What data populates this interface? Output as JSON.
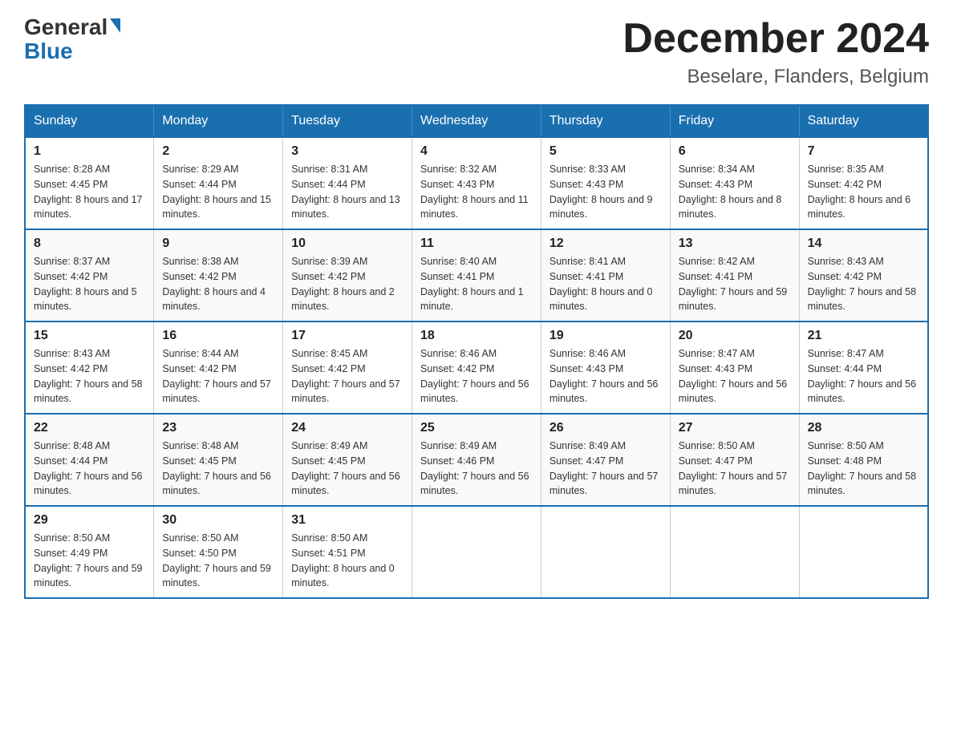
{
  "logo": {
    "general": "General",
    "blue": "Blue",
    "triangle": "▶"
  },
  "title": {
    "month": "December 2024",
    "location": "Beselare, Flanders, Belgium"
  },
  "weekdays": [
    "Sunday",
    "Monday",
    "Tuesday",
    "Wednesday",
    "Thursday",
    "Friday",
    "Saturday"
  ],
  "weeks": [
    [
      {
        "day": "1",
        "sunrise": "8:28 AM",
        "sunset": "4:45 PM",
        "daylight": "8 hours and 17 minutes."
      },
      {
        "day": "2",
        "sunrise": "8:29 AM",
        "sunset": "4:44 PM",
        "daylight": "8 hours and 15 minutes."
      },
      {
        "day": "3",
        "sunrise": "8:31 AM",
        "sunset": "4:44 PM",
        "daylight": "8 hours and 13 minutes."
      },
      {
        "day": "4",
        "sunrise": "8:32 AM",
        "sunset": "4:43 PM",
        "daylight": "8 hours and 11 minutes."
      },
      {
        "day": "5",
        "sunrise": "8:33 AM",
        "sunset": "4:43 PM",
        "daylight": "8 hours and 9 minutes."
      },
      {
        "day": "6",
        "sunrise": "8:34 AM",
        "sunset": "4:43 PM",
        "daylight": "8 hours and 8 minutes."
      },
      {
        "day": "7",
        "sunrise": "8:35 AM",
        "sunset": "4:42 PM",
        "daylight": "8 hours and 6 minutes."
      }
    ],
    [
      {
        "day": "8",
        "sunrise": "8:37 AM",
        "sunset": "4:42 PM",
        "daylight": "8 hours and 5 minutes."
      },
      {
        "day": "9",
        "sunrise": "8:38 AM",
        "sunset": "4:42 PM",
        "daylight": "8 hours and 4 minutes."
      },
      {
        "day": "10",
        "sunrise": "8:39 AM",
        "sunset": "4:42 PM",
        "daylight": "8 hours and 2 minutes."
      },
      {
        "day": "11",
        "sunrise": "8:40 AM",
        "sunset": "4:41 PM",
        "daylight": "8 hours and 1 minute."
      },
      {
        "day": "12",
        "sunrise": "8:41 AM",
        "sunset": "4:41 PM",
        "daylight": "8 hours and 0 minutes."
      },
      {
        "day": "13",
        "sunrise": "8:42 AM",
        "sunset": "4:41 PM",
        "daylight": "7 hours and 59 minutes."
      },
      {
        "day": "14",
        "sunrise": "8:43 AM",
        "sunset": "4:42 PM",
        "daylight": "7 hours and 58 minutes."
      }
    ],
    [
      {
        "day": "15",
        "sunrise": "8:43 AM",
        "sunset": "4:42 PM",
        "daylight": "7 hours and 58 minutes."
      },
      {
        "day": "16",
        "sunrise": "8:44 AM",
        "sunset": "4:42 PM",
        "daylight": "7 hours and 57 minutes."
      },
      {
        "day": "17",
        "sunrise": "8:45 AM",
        "sunset": "4:42 PM",
        "daylight": "7 hours and 57 minutes."
      },
      {
        "day": "18",
        "sunrise": "8:46 AM",
        "sunset": "4:42 PM",
        "daylight": "7 hours and 56 minutes."
      },
      {
        "day": "19",
        "sunrise": "8:46 AM",
        "sunset": "4:43 PM",
        "daylight": "7 hours and 56 minutes."
      },
      {
        "day": "20",
        "sunrise": "8:47 AM",
        "sunset": "4:43 PM",
        "daylight": "7 hours and 56 minutes."
      },
      {
        "day": "21",
        "sunrise": "8:47 AM",
        "sunset": "4:44 PM",
        "daylight": "7 hours and 56 minutes."
      }
    ],
    [
      {
        "day": "22",
        "sunrise": "8:48 AM",
        "sunset": "4:44 PM",
        "daylight": "7 hours and 56 minutes."
      },
      {
        "day": "23",
        "sunrise": "8:48 AM",
        "sunset": "4:45 PM",
        "daylight": "7 hours and 56 minutes."
      },
      {
        "day": "24",
        "sunrise": "8:49 AM",
        "sunset": "4:45 PM",
        "daylight": "7 hours and 56 minutes."
      },
      {
        "day": "25",
        "sunrise": "8:49 AM",
        "sunset": "4:46 PM",
        "daylight": "7 hours and 56 minutes."
      },
      {
        "day": "26",
        "sunrise": "8:49 AM",
        "sunset": "4:47 PM",
        "daylight": "7 hours and 57 minutes."
      },
      {
        "day": "27",
        "sunrise": "8:50 AM",
        "sunset": "4:47 PM",
        "daylight": "7 hours and 57 minutes."
      },
      {
        "day": "28",
        "sunrise": "8:50 AM",
        "sunset": "4:48 PM",
        "daylight": "7 hours and 58 minutes."
      }
    ],
    [
      {
        "day": "29",
        "sunrise": "8:50 AM",
        "sunset": "4:49 PM",
        "daylight": "7 hours and 59 minutes."
      },
      {
        "day": "30",
        "sunrise": "8:50 AM",
        "sunset": "4:50 PM",
        "daylight": "7 hours and 59 minutes."
      },
      {
        "day": "31",
        "sunrise": "8:50 AM",
        "sunset": "4:51 PM",
        "daylight": "8 hours and 0 minutes."
      },
      null,
      null,
      null,
      null
    ]
  ],
  "labels": {
    "sunrise": "Sunrise:",
    "sunset": "Sunset:",
    "daylight": "Daylight:"
  }
}
